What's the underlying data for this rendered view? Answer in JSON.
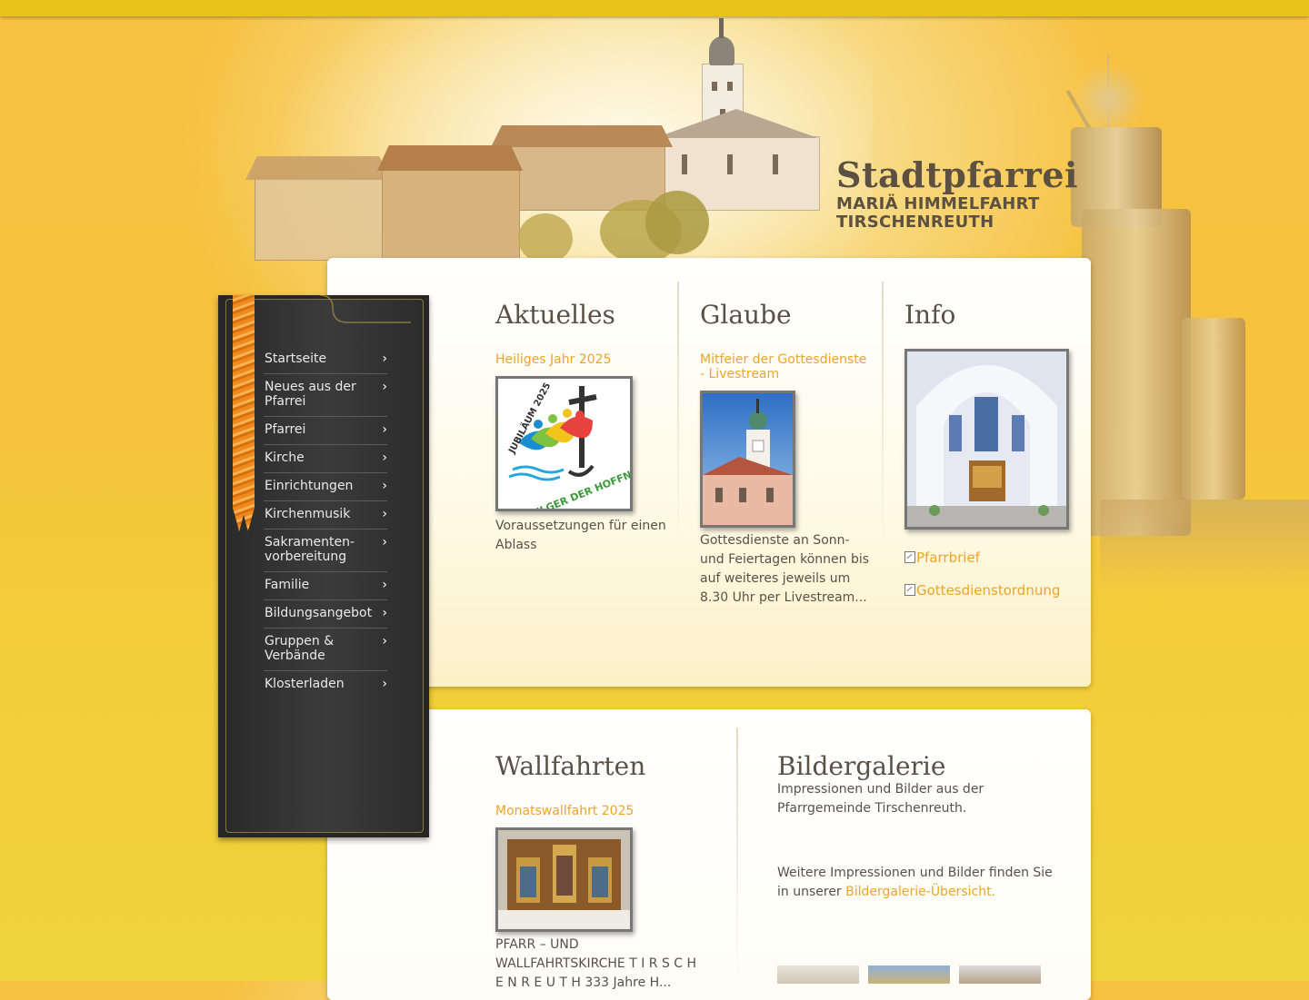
{
  "header": {
    "title": "Stadtpfarrei",
    "subtitle_line1": "MARIÄ HIMMELFAHRT",
    "subtitle_line2": "TIRSCHENREUTH"
  },
  "sidebar": {
    "items": [
      {
        "label": "Startseite"
      },
      {
        "label": "Neues aus der Pfarrei"
      },
      {
        "label": "Pfarrei"
      },
      {
        "label": "Kirche"
      },
      {
        "label": "Einrichtungen"
      },
      {
        "label": "Kirchenmusik"
      },
      {
        "label": "Sakramenten-vorbereitung"
      },
      {
        "label": "Familie"
      },
      {
        "label": "Bildungsangebot"
      },
      {
        "label": "Gruppen & Verbände"
      },
      {
        "label": "Klosterladen"
      }
    ],
    "chevron": "›"
  },
  "aktuelles": {
    "heading": "Aktuelles",
    "link": "Heiliges Jahr 2025",
    "logo_text_top": "JUBILÄUM 2025",
    "logo_text_bottom": "PILGER DER HOFFNUNG",
    "text": "Voraussetzungen für einen Ablass"
  },
  "glaube": {
    "heading": "Glaube",
    "link": "Mitfeier der Gottesdienste - Livestream",
    "text": "Gottesdienste an Sonn- und Feiertagen können bis auf weiteres jeweils um 8.30 Uhr per Livestream..."
  },
  "info": {
    "heading": "Info",
    "links": [
      "Pfarrbrief",
      "Gottesdienstordnung"
    ]
  },
  "wallfahrten": {
    "heading": "Wallfahrten",
    "link": "Monatswallfahrt 2025",
    "text": "PFARR – UND WALLFAHRTSKIRCHE T I R S C H E N R E U T H 333 Jahre H..."
  },
  "bildergalerie": {
    "heading": "Bildergalerie",
    "intro": "Impressionen und Bilder aus der Pfarrgemeinde Tirschenreuth.",
    "more_text": "Weitere Impressionen und Bilder finden Sie in unserer ",
    "more_link": "Bildergalerie-Übersicht."
  },
  "colors": {
    "accent": "#eea428",
    "heading": "#5b5045",
    "topbar": "#e9c31b"
  }
}
